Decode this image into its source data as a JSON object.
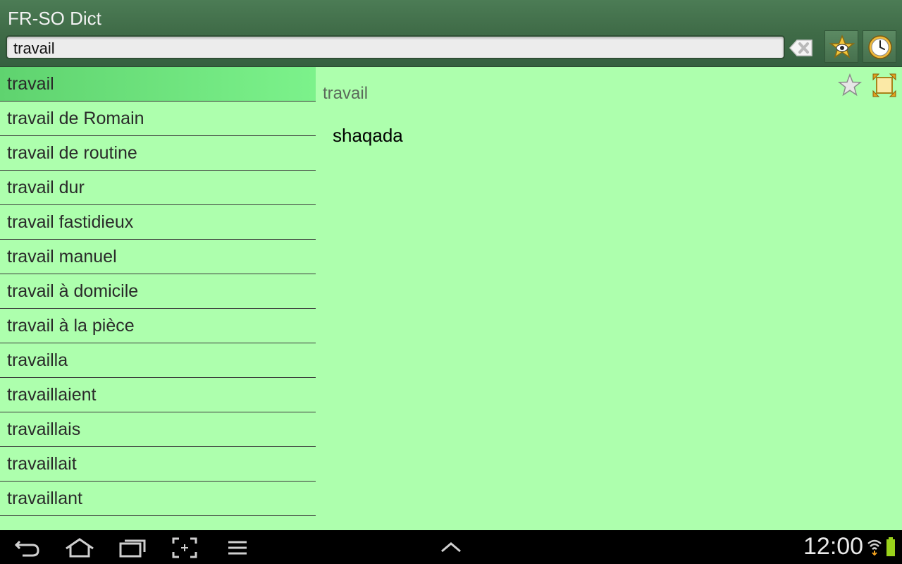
{
  "app": {
    "title": "FR-SO Dict"
  },
  "search": {
    "value": "travail"
  },
  "toolbar": {
    "clear_icon": "clear-text-icon",
    "favorites_icon": "star-eye-icon",
    "history_icon": "clock-icon"
  },
  "word_list": [
    {
      "label": "travail",
      "selected": true
    },
    {
      "label": "travail de Romain"
    },
    {
      "label": "travail de routine"
    },
    {
      "label": "travail dur"
    },
    {
      "label": "travail fastidieux"
    },
    {
      "label": "travail manuel"
    },
    {
      "label": "travail à domicile"
    },
    {
      "label": "travail à la pièce"
    },
    {
      "label": "travailla"
    },
    {
      "label": "travaillaient"
    },
    {
      "label": "travaillais"
    },
    {
      "label": "travaillait"
    },
    {
      "label": "travaillant"
    }
  ],
  "detail": {
    "word": "travail",
    "translation": "shaqada",
    "favorite_icon": "star-icon",
    "fullscreen_icon": "fullscreen-icon"
  },
  "system_bar": {
    "time": "12:00",
    "icons": [
      "back-icon",
      "home-icon",
      "recent-apps-icon",
      "screenshot-icon",
      "menu-icon",
      "up-arrow-icon",
      "wifi-icon",
      "battery-icon"
    ]
  },
  "colors": {
    "list_bg": "#adffad",
    "selected_item": "#6be67b",
    "header": "#3f6b47"
  }
}
